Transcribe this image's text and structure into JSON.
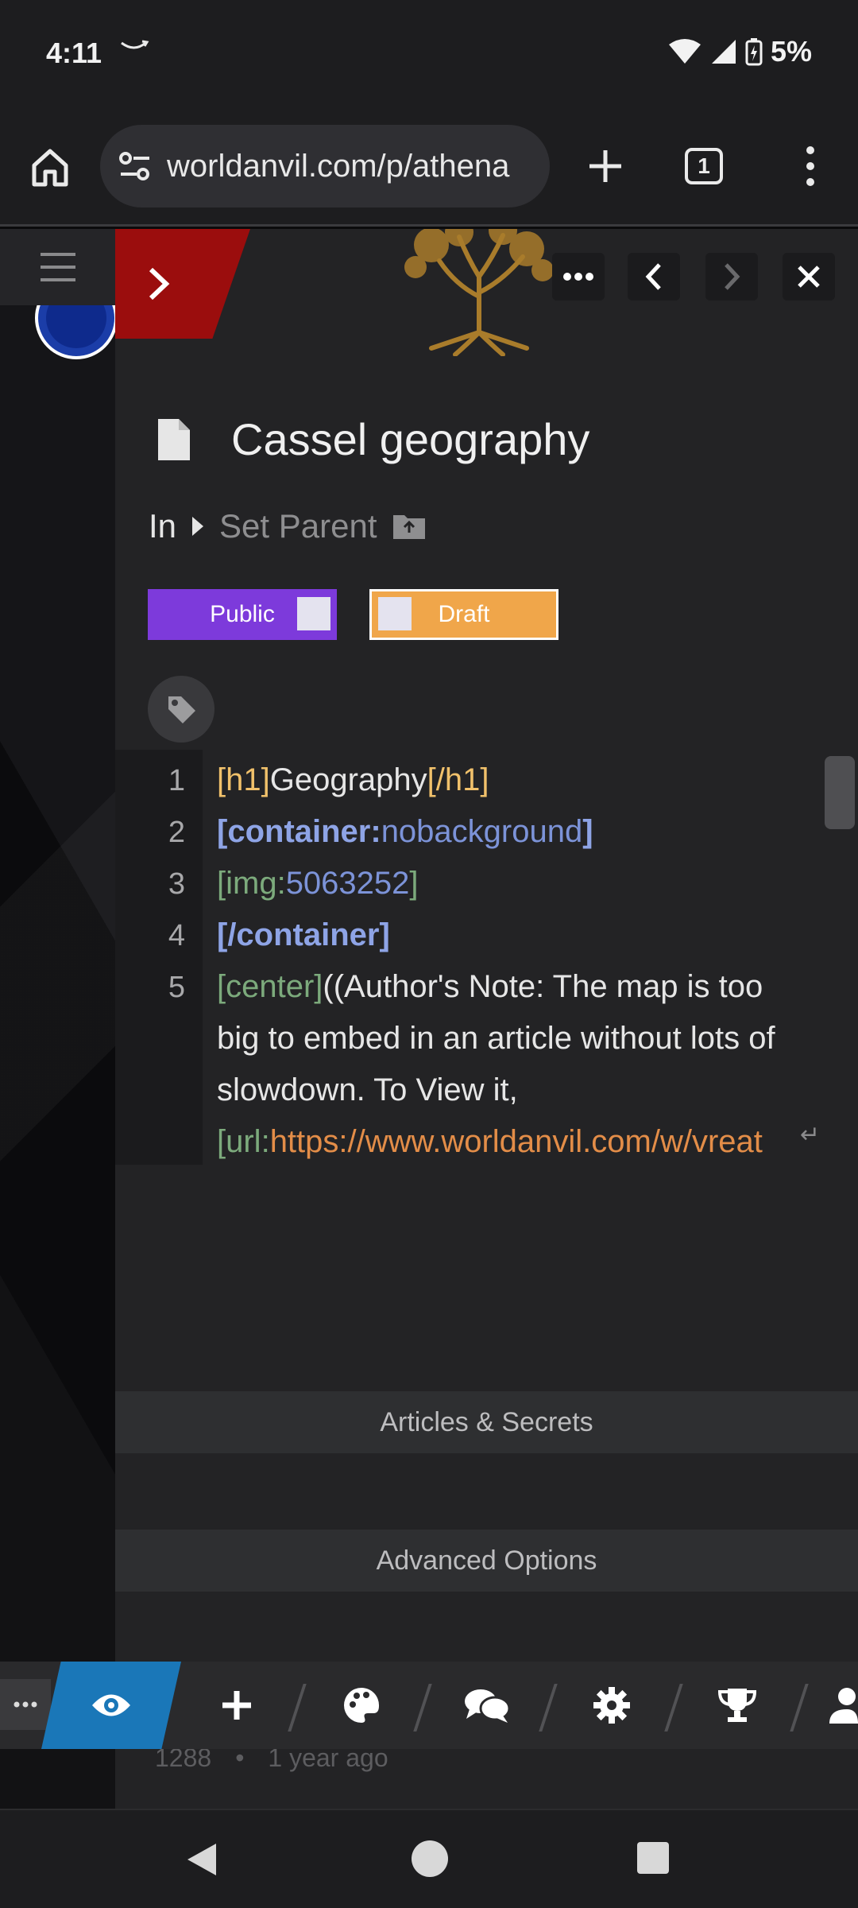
{
  "status_bar": {
    "time": "4:11",
    "battery": "5%"
  },
  "browser": {
    "url": "worldanvil.com/p/athena",
    "tab_count": "1"
  },
  "article": {
    "title": "Cassel geography",
    "parent_in_label": "In",
    "set_parent_label": "Set Parent",
    "public_label": "Public",
    "draft_label": "Draft"
  },
  "editor": {
    "line_numbers": [
      "1",
      "2",
      "3",
      "4",
      "5"
    ],
    "line1": {
      "open": "[h1]",
      "text": "Geography",
      "close": "[/h1]"
    },
    "line2": {
      "open": "[",
      "tag": "container:",
      "value": "nobackground",
      "close": "]"
    },
    "line3": {
      "open": "[img:",
      "value": "5063252",
      "close": "]"
    },
    "line4": {
      "text": "[/container]"
    },
    "line5": {
      "tag": "[center]",
      "text_a": "((Author's Note: The map is too",
      "text_b": "big to embed in an article without lots of",
      "text_c": "slowdown. To View it,",
      "url_tag": "[url:",
      "url_value": "https://www.worldanvil.com/w/vreat"
    }
  },
  "sections": {
    "articles_secrets": "Articles & Secrets",
    "advanced_options": "Advanced Options"
  },
  "footer_meta": {
    "views": "1288",
    "age": "1 year ago"
  },
  "colors": {
    "public_toggle": "#7d3adb",
    "draft_toggle": "#f0a64a",
    "red_tab": "#9b0d0d",
    "active_toolbar": "#1a77b8"
  },
  "icons": {
    "toolbar": [
      "more-icon",
      "eye-icon",
      "plus-icon",
      "palette-icon",
      "comments-icon",
      "gear-icon",
      "trophy-icon",
      "user-icon"
    ]
  }
}
